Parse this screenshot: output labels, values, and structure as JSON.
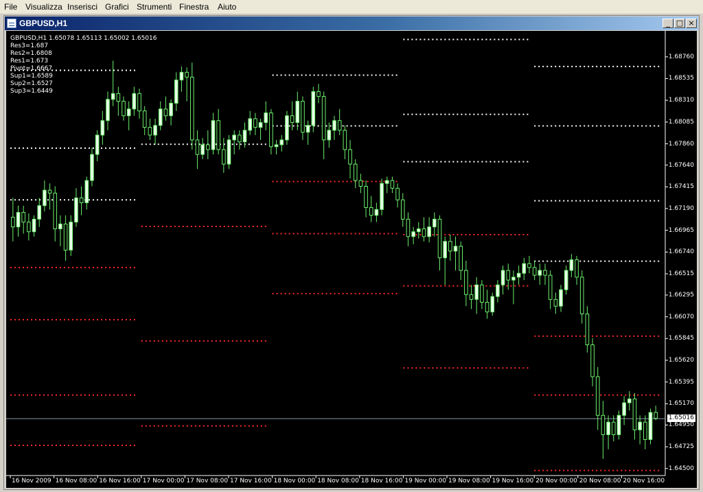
{
  "menu": [
    "File",
    "Visualizza",
    "Inserisci",
    "Grafici",
    "Strumenti",
    "Finestra",
    "Aiuto"
  ],
  "window": {
    "title": "GBPUSD,H1",
    "buttons": [
      "_",
      "□",
      "×"
    ]
  },
  "indicator": {
    "header": "GBPUSD,H1  1.65078 1.65113 1.65002 1.65016",
    "levels": [
      "Res3=1.687",
      "Res2=1.6808",
      "Res1=1.673",
      "Pivot=1.6667",
      "Sup1=1.6589",
      "Sup2=1.6527",
      "Sup3=1.6449"
    ]
  },
  "colors": {
    "bull": "#e8ffe8",
    "bear": "#000000",
    "wick": "#6cf26c",
    "resistance": "#ffffff",
    "support": "#ff2a2a",
    "bg": "#000000"
  },
  "chart_data": {
    "type": "candlestick",
    "symbol": "GBPUSD",
    "timeframe": "H1",
    "y_ticks": [
      1.6876,
      1.68535,
      1.6831,
      1.68085,
      1.6786,
      1.6764,
      1.67415,
      1.6719,
      1.66965,
      1.6674,
      1.66515,
      1.66295,
      1.6607,
      1.65845,
      1.6562,
      1.65395,
      1.6517,
      1.6495,
      1.64725,
      1.645
    ],
    "ylim": [
      1.6447,
      1.69
    ],
    "current_price": 1.65016,
    "x_labels": [
      "16 Nov 2009",
      "16 Nov 08:00",
      "16 Nov 16:00",
      "17 Nov 00:00",
      "17 Nov 08:00",
      "17 Nov 16:00",
      "18 Nov 00:00",
      "18 Nov 08:00",
      "18 Nov 16:00",
      "19 Nov 00:00",
      "19 Nov 08:00",
      "19 Nov 16:00",
      "20 Nov 00:00",
      "20 Nov 08:00",
      "20 Nov 16:00"
    ],
    "pivot_days": [
      {
        "res": [
          1.6862,
          1.67815,
          1.6728
        ],
        "sup": [
          1.6658,
          1.6604,
          1.6526,
          1.6474
        ]
      },
      {
        "res": [
          1.67855
        ],
        "sup": [
          1.67005,
          1.6582,
          1.6494
        ]
      },
      {
        "res": [
          1.6857,
          1.68045
        ],
        "sup": [
          1.6747,
          1.6693,
          1.6631
        ]
      },
      {
        "res": [
          1.6894,
          1.68165,
          1.67675
        ],
        "sup": [
          1.6692,
          1.6639,
          1.6554
        ]
      },
      {
        "res": [
          1.6866,
          1.68045,
          1.6727,
          1.66645
        ],
        "sup": [
          1.6587,
          1.6526,
          1.6448
        ]
      }
    ],
    "candles": [
      [
        1.671,
        1.673,
        1.6685,
        1.67
      ],
      [
        1.67,
        1.6722,
        1.669,
        1.6715
      ],
      [
        1.6715,
        1.6722,
        1.6693,
        1.6705
      ],
      [
        1.6705,
        1.6714,
        1.6686,
        1.6695
      ],
      [
        1.6695,
        1.6712,
        1.669,
        1.6708
      ],
      [
        1.6708,
        1.673,
        1.67,
        1.6722
      ],
      [
        1.6722,
        1.6748,
        1.6716,
        1.6738
      ],
      [
        1.6738,
        1.6745,
        1.6718,
        1.6735
      ],
      [
        1.6735,
        1.6742,
        1.6685,
        1.6698
      ],
      [
        1.6698,
        1.6712,
        1.668,
        1.6703
      ],
      [
        1.6703,
        1.6712,
        1.6665,
        1.6676
      ],
      [
        1.6676,
        1.6712,
        1.667,
        1.6705
      ],
      [
        1.6705,
        1.674,
        1.67,
        1.673
      ],
      [
        1.673,
        1.6742,
        1.6712,
        1.6725
      ],
      [
        1.6725,
        1.6752,
        1.6718,
        1.6748
      ],
      [
        1.6748,
        1.6782,
        1.6742,
        1.6775
      ],
      [
        1.6775,
        1.68,
        1.6768,
        1.6795
      ],
      [
        1.6795,
        1.682,
        1.6785,
        1.681
      ],
      [
        1.681,
        1.684,
        1.68,
        1.6832
      ],
      [
        1.6832,
        1.6872,
        1.6825,
        1.6838
      ],
      [
        1.6838,
        1.6845,
        1.6815,
        1.683
      ],
      [
        1.683,
        1.6835,
        1.681,
        1.6815
      ],
      [
        1.6815,
        1.683,
        1.68,
        1.6822
      ],
      [
        1.6822,
        1.6845,
        1.6815,
        1.6838
      ],
      [
        1.6838,
        1.6843,
        1.6812,
        1.682
      ],
      [
        1.682,
        1.6825,
        1.6795,
        1.6803
      ],
      [
        1.6803,
        1.6812,
        1.679,
        1.6795
      ],
      [
        1.6795,
        1.6812,
        1.6785,
        1.6805
      ],
      [
        1.6805,
        1.683,
        1.68,
        1.6822
      ],
      [
        1.6822,
        1.6835,
        1.681,
        1.6815
      ],
      [
        1.6815,
        1.6832,
        1.6805,
        1.6828
      ],
      [
        1.6828,
        1.686,
        1.682,
        1.6852
      ],
      [
        1.6852,
        1.6866,
        1.684,
        1.686
      ],
      [
        1.686,
        1.6865,
        1.683,
        1.6855
      ],
      [
        1.6855,
        1.687,
        1.678,
        1.679
      ],
      [
        1.679,
        1.68,
        1.676,
        1.6775
      ],
      [
        1.6775,
        1.6792,
        1.677,
        1.6785
      ],
      [
        1.6785,
        1.68,
        1.677,
        1.678
      ],
      [
        1.678,
        1.6818,
        1.6775,
        1.681
      ],
      [
        1.681,
        1.6822,
        1.6775,
        1.678
      ],
      [
        1.678,
        1.6792,
        1.6756,
        1.6765
      ],
      [
        1.6765,
        1.6795,
        1.676,
        1.679
      ],
      [
        1.679,
        1.68,
        1.6775,
        1.6795
      ],
      [
        1.6795,
        1.68,
        1.678,
        1.6788
      ],
      [
        1.6788,
        1.6808,
        1.6782,
        1.68
      ],
      [
        1.68,
        1.682,
        1.6795,
        1.6812
      ],
      [
        1.6812,
        1.6818,
        1.6795,
        1.6803
      ],
      [
        1.6803,
        1.6812,
        1.679,
        1.6808
      ],
      [
        1.6808,
        1.683,
        1.68,
        1.6818
      ],
      [
        1.6818,
        1.6822,
        1.6775,
        1.6783
      ],
      [
        1.6783,
        1.679,
        1.6775,
        1.6785
      ],
      [
        1.6785,
        1.6795,
        1.6778,
        1.679
      ],
      [
        1.679,
        1.682,
        1.6785,
        1.6815
      ],
      [
        1.6815,
        1.683,
        1.68,
        1.6808
      ],
      [
        1.6808,
        1.684,
        1.68,
        1.683
      ],
      [
        1.683,
        1.6835,
        1.679,
        1.6798
      ],
      [
        1.6798,
        1.681,
        1.6785,
        1.6805
      ],
      [
        1.6805,
        1.6845,
        1.6798,
        1.684
      ],
      [
        1.684,
        1.6848,
        1.6828,
        1.6835
      ],
      [
        1.6835,
        1.684,
        1.677,
        1.679
      ],
      [
        1.679,
        1.6808,
        1.6782,
        1.68
      ],
      [
        1.68,
        1.6815,
        1.679,
        1.681
      ],
      [
        1.681,
        1.6822,
        1.6795,
        1.68
      ],
      [
        1.68,
        1.6805,
        1.677,
        1.678
      ],
      [
        1.678,
        1.679,
        1.675,
        1.6765
      ],
      [
        1.6765,
        1.677,
        1.674,
        1.6748
      ],
      [
        1.6748,
        1.6755,
        1.6735,
        1.6742
      ],
      [
        1.6742,
        1.6748,
        1.671,
        1.672
      ],
      [
        1.672,
        1.6732,
        1.6705,
        1.6712
      ],
      [
        1.6712,
        1.6725,
        1.6705,
        1.6718
      ],
      [
        1.6718,
        1.675,
        1.6712,
        1.6745
      ],
      [
        1.6745,
        1.6752,
        1.6735,
        1.6748
      ],
      [
        1.6748,
        1.6752,
        1.6735,
        1.674
      ],
      [
        1.674,
        1.6745,
        1.672,
        1.6728
      ],
      [
        1.6728,
        1.6735,
        1.67,
        1.6708
      ],
      [
        1.6708,
        1.6715,
        1.668,
        1.669
      ],
      [
        1.669,
        1.67,
        1.6682,
        1.6695
      ],
      [
        1.6695,
        1.6705,
        1.6688,
        1.6698
      ],
      [
        1.6698,
        1.671,
        1.6685,
        1.669
      ],
      [
        1.669,
        1.671,
        1.6684,
        1.67
      ],
      [
        1.67,
        1.6715,
        1.669,
        1.6708
      ],
      [
        1.6708,
        1.6712,
        1.6655,
        1.6668
      ],
      [
        1.6668,
        1.669,
        1.664,
        1.6685
      ],
      [
        1.6685,
        1.6692,
        1.6665,
        1.6675
      ],
      [
        1.6675,
        1.669,
        1.6655,
        1.668
      ],
      [
        1.668,
        1.6685,
        1.6645,
        1.6655
      ],
      [
        1.6655,
        1.6665,
        1.6618,
        1.663
      ],
      [
        1.663,
        1.664,
        1.6615,
        1.6625
      ],
      [
        1.6625,
        1.6648,
        1.661,
        1.664
      ],
      [
        1.664,
        1.6645,
        1.6615,
        1.6622
      ],
      [
        1.6622,
        1.6635,
        1.6605,
        1.6612
      ],
      [
        1.6612,
        1.6632,
        1.6608,
        1.6628
      ],
      [
        1.6628,
        1.6645,
        1.6622,
        1.664
      ],
      [
        1.664,
        1.666,
        1.663,
        1.6655
      ],
      [
        1.6655,
        1.6662,
        1.6635,
        1.6645
      ],
      [
        1.6645,
        1.6655,
        1.662,
        1.6648
      ],
      [
        1.6648,
        1.666,
        1.664,
        1.6652
      ],
      [
        1.6652,
        1.6668,
        1.6645,
        1.6662
      ],
      [
        1.6662,
        1.667,
        1.6652,
        1.6658
      ],
      [
        1.6658,
        1.6665,
        1.6645,
        1.665
      ],
      [
        1.665,
        1.6662,
        1.664,
        1.6655
      ],
      [
        1.6655,
        1.6662,
        1.664,
        1.665
      ],
      [
        1.665,
        1.6655,
        1.6615,
        1.6625
      ],
      [
        1.6625,
        1.6632,
        1.661,
        1.6618
      ],
      [
        1.6618,
        1.664,
        1.6612,
        1.6635
      ],
      [
        1.6635,
        1.666,
        1.663,
        1.6655
      ],
      [
        1.6655,
        1.6672,
        1.6648,
        1.6666
      ],
      [
        1.6666,
        1.667,
        1.664,
        1.6648
      ],
      [
        1.6648,
        1.6655,
        1.66,
        1.661
      ],
      [
        1.661,
        1.6618,
        1.657,
        1.6578
      ],
      [
        1.6578,
        1.6585,
        1.6535,
        1.6545
      ],
      [
        1.6545,
        1.6555,
        1.649,
        1.6505
      ],
      [
        1.6505,
        1.652,
        1.646,
        1.6485
      ],
      [
        1.6485,
        1.6505,
        1.647,
        1.6498
      ],
      [
        1.6498,
        1.6505,
        1.6478,
        1.6485
      ],
      [
        1.6485,
        1.651,
        1.648,
        1.6505
      ],
      [
        1.6505,
        1.6525,
        1.6495,
        1.6518
      ],
      [
        1.6518,
        1.653,
        1.651,
        1.6522
      ],
      [
        1.6522,
        1.6528,
        1.648,
        1.649
      ],
      [
        1.649,
        1.6505,
        1.6475,
        1.6498
      ],
      [
        1.6498,
        1.6505,
        1.647,
        1.648
      ],
      [
        1.648,
        1.6512,
        1.6475,
        1.6508
      ],
      [
        1.6508,
        1.6515,
        1.65,
        1.6502
      ]
    ]
  }
}
